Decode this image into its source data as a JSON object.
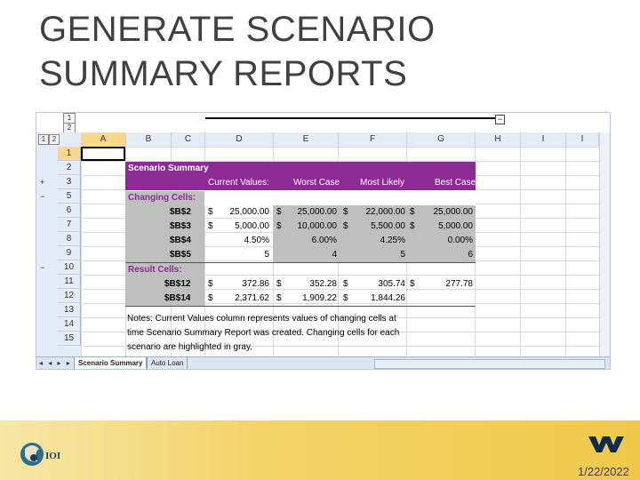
{
  "slide": {
    "title_line1": "GENERATE SCENARIO",
    "title_line2": "SUMMARY REPORTS",
    "date": "1/22/2022"
  },
  "spreadsheet": {
    "outline_levels": [
      "1",
      "2"
    ],
    "columns": [
      "A",
      "B",
      "C",
      "D",
      "E",
      "F",
      "G",
      "H",
      "I",
      "I"
    ],
    "rows": [
      "1",
      "2",
      "3",
      "5",
      "6",
      "7",
      "8",
      "9",
      "10",
      "11",
      "12",
      "13",
      "14",
      "15"
    ],
    "outline_symbols": {
      "plus": "+",
      "minus": "−"
    },
    "tabs": [
      "Scenario Summary",
      "Auto Loan"
    ],
    "tab_nav": "◂ ◂ ▸ ▸"
  },
  "report": {
    "title": "Scenario Summary",
    "headers": [
      "Current Values:",
      "Worst Case",
      "Most Likely",
      "Best Case"
    ],
    "changing_label": "Changing Cells:",
    "changing_rows": [
      {
        "cell": "$B$2",
        "vals": [
          "$",
          "25,000.00",
          "$",
          "25,000.00",
          "$",
          "22,000.00",
          "$",
          "25,000.00"
        ]
      },
      {
        "cell": "$B$3",
        "vals": [
          "$",
          "5,000.00",
          "$",
          "10,000.00",
          "$",
          "5,500.00",
          "$",
          "5,000.00"
        ]
      },
      {
        "cell": "$B$4",
        "vals": [
          "",
          "4.50%",
          "",
          "6.00%",
          "",
          "4.25%",
          "",
          "0.00%"
        ]
      },
      {
        "cell": "$B$5",
        "vals": [
          "",
          "5",
          "",
          "4",
          "",
          "5",
          "",
          "6"
        ]
      }
    ],
    "result_label": "Result Cells:",
    "result_rows": [
      {
        "cell": "$B$12",
        "vals": [
          "$",
          "372.86",
          "$",
          "352.28",
          "$",
          "305.74",
          "$",
          "277.78"
        ]
      },
      {
        "cell": "$B$14",
        "vals": [
          "$",
          "2,371.62",
          "$",
          "1,909.22",
          "$",
          "1,844.26",
          "",
          ""
        ]
      }
    ],
    "notes": [
      "Notes:  Current Values column represents values of changing cells at",
      "time Scenario Summary Report was created.  Changing cells for each",
      "scenario are highlighted in gray."
    ]
  },
  "colors": {
    "header_purple": "#8b2b93",
    "changing_gray": "#bfbfbf",
    "footer_gold": "#f0c94a"
  }
}
